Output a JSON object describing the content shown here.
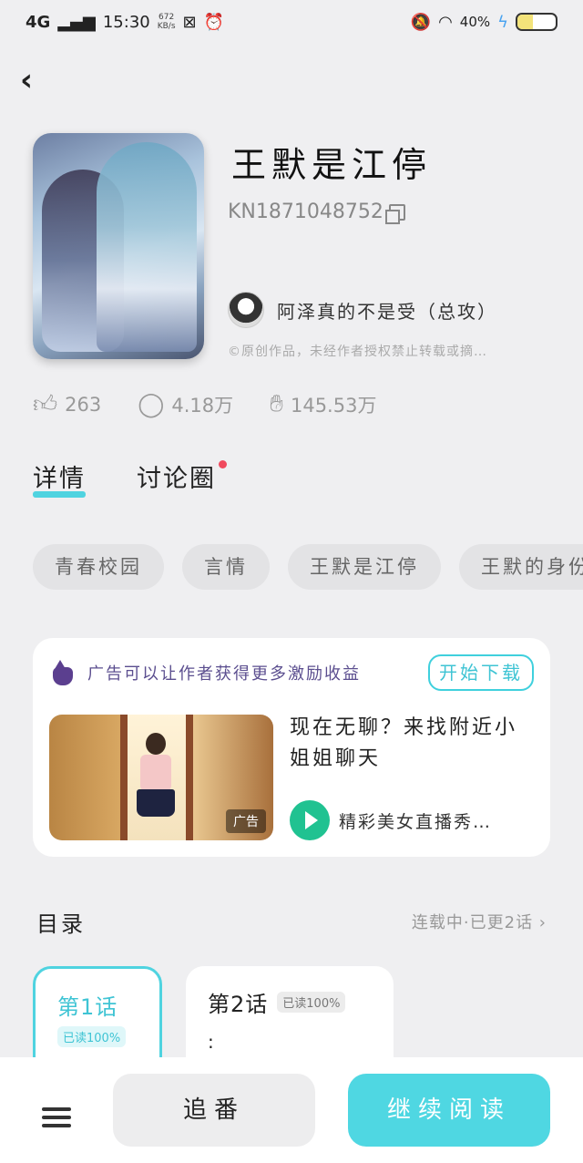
{
  "status_bar": {
    "network": "4G",
    "time": "15:30",
    "speed_value": "672",
    "speed_unit": "KB/s",
    "battery_text": "40%",
    "battery_level": 0.4
  },
  "book": {
    "title": "王默是江停",
    "id": "KN1871048752",
    "author": "阿泽真的不是受（总攻）",
    "copyright": "©原创作品，未经作者授权禁止转载或摘…"
  },
  "stats": {
    "likes": "263",
    "comments": "4.18万",
    "popularity": "145.53万"
  },
  "tabs": [
    {
      "label": "详情"
    },
    {
      "label": "讨论圈"
    }
  ],
  "tags": [
    "青春校园",
    "言情",
    "王默是江停",
    "王默的身份"
  ],
  "ad": {
    "header_text": "广告可以让作者获得更多激励收益",
    "download_label": "开始下载",
    "title": "现在无聊？来找附近小姐姐聊天",
    "badge": "广告",
    "app_name": "精彩美女直播秀…"
  },
  "toc": {
    "label": "目录",
    "status": "连载中·已更2话 ›",
    "chapters": [
      {
        "name": "第1话",
        "read": "已读100%"
      },
      {
        "name": "第2话",
        "read": "已读100%",
        "snippet": ":"
      }
    ]
  },
  "bottom": {
    "follow_label": "追番",
    "read_label": "继续阅读"
  }
}
